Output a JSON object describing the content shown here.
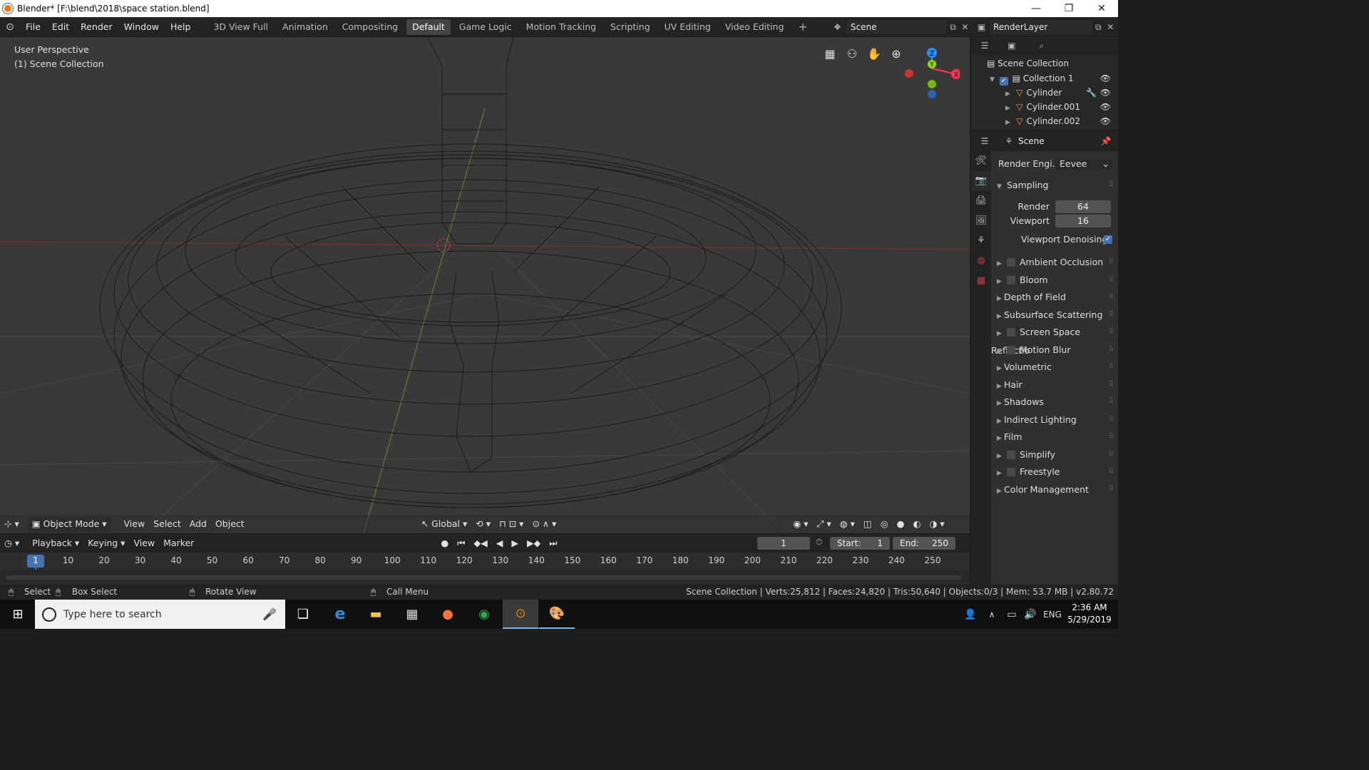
{
  "window": {
    "title": "Blender* [F:\\blend\\2018\\space station.blend]",
    "controls": [
      "—",
      "❐",
      "✕"
    ]
  },
  "menu": [
    "File",
    "Edit",
    "Render",
    "Window",
    "Help"
  ],
  "workspaces": [
    "3D View Full",
    "Animation",
    "Compositing",
    "Default",
    "Game Logic",
    "Motion Tracking",
    "Scripting",
    "UV Editing",
    "Video Editing"
  ],
  "active_workspace": "Default",
  "scene_name": "Scene",
  "render_layer": "RenderLayer",
  "viewport": {
    "info_line1": "User Perspective",
    "info_line2": "(1) Scene Collection",
    "gizmo": {
      "x": "X",
      "y": "Y",
      "z": "Z"
    },
    "header": {
      "mode": "Object Mode",
      "menus": [
        "View",
        "Select",
        "Add",
        "Object"
      ],
      "orientation": "Global"
    }
  },
  "outliner": {
    "root": "Scene Collection",
    "collection": "Collection 1",
    "objects": [
      "Cylinder",
      "Cylinder.001",
      "Cylinder.002"
    ]
  },
  "properties": {
    "context": "Scene",
    "render_engine_label": "Render Engi..",
    "render_engine": "Eevee",
    "sampling": {
      "title": "Sampling",
      "render_label": "Render",
      "render": "64",
      "viewport_label": "Viewport",
      "viewport": "16",
      "denoise_label": "Viewport Denoising",
      "denoise": true
    },
    "panels": [
      {
        "label": "Ambient Occlusion",
        "checkbox": true
      },
      {
        "label": "Bloom",
        "checkbox": true
      },
      {
        "label": "Depth of Field",
        "checkbox": false
      },
      {
        "label": "Subsurface Scattering",
        "checkbox": false
      },
      {
        "label": "Screen Space Reflectio",
        "checkbox": true
      },
      {
        "label": "Motion Blur",
        "checkbox": true
      },
      {
        "label": "Volumetric",
        "checkbox": false
      },
      {
        "label": "Hair",
        "checkbox": false
      },
      {
        "label": "Shadows",
        "checkbox": false
      },
      {
        "label": "Indirect Lighting",
        "checkbox": false
      },
      {
        "label": "Film",
        "checkbox": false
      },
      {
        "label": "Simplify",
        "checkbox": true
      },
      {
        "label": "Freestyle",
        "checkbox": true
      },
      {
        "label": "Color Management",
        "checkbox": false
      }
    ]
  },
  "timeline": {
    "menus": [
      "Playback",
      "Keying",
      "View",
      "Marker"
    ],
    "current_frame": "1",
    "start_label": "Start:",
    "start": "1",
    "end_label": "End:",
    "end": "250",
    "ruler": [
      "1",
      "10",
      "20",
      "30",
      "40",
      "50",
      "60",
      "70",
      "80",
      "90",
      "100",
      "110",
      "120",
      "130",
      "140",
      "150",
      "160",
      "170",
      "180",
      "190",
      "200",
      "210",
      "220",
      "230",
      "240",
      "250"
    ]
  },
  "statusbar": {
    "select": "Select",
    "box_select": "Box Select",
    "rotate": "Rotate View",
    "call_menu": "Call Menu",
    "stats": "Scene Collection | Verts:25,812 | Faces:24,820 | Tris:50,640 | Objects:0/3 | Mem: 53.7 MB | v2.80.72"
  },
  "taskbar": {
    "search_placeholder": "Type here to search",
    "lang": "ENG",
    "time": "2:36 AM",
    "date": "5/29/2019"
  },
  "colors": {
    "accent": "#4772b3",
    "x_axis": "#ff3352",
    "y_axis": "#8bdc00",
    "z_axis": "#2890ff",
    "blender_orange": "#e87d0d"
  }
}
